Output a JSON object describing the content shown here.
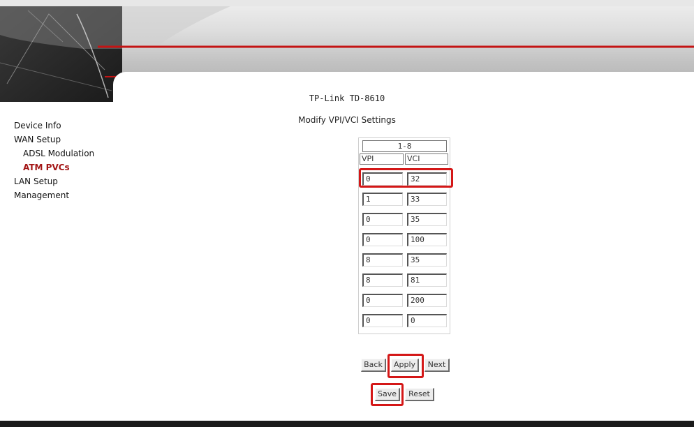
{
  "sidebar": {
    "items": [
      {
        "label": "Device Info"
      },
      {
        "label": "WAN Setup"
      },
      {
        "label": "ADSL Modulation"
      },
      {
        "label": "ATM PVCs"
      },
      {
        "label": "LAN Setup"
      },
      {
        "label": "Management"
      }
    ]
  },
  "main": {
    "device_title": "TP-Link TD-8610",
    "page_title": "Modify VPI/VCI Settings",
    "range_label": "1-8",
    "columns": {
      "vpi": "VPI",
      "vci": "VCI"
    },
    "rows": [
      {
        "vpi": "0",
        "vci": "32"
      },
      {
        "vpi": "1",
        "vci": "33"
      },
      {
        "vpi": "0",
        "vci": "35"
      },
      {
        "vpi": "0",
        "vci": "100"
      },
      {
        "vpi": "8",
        "vci": "35"
      },
      {
        "vpi": "8",
        "vci": "81"
      },
      {
        "vpi": "0",
        "vci": "200"
      },
      {
        "vpi": "0",
        "vci": "0"
      }
    ],
    "buttons": {
      "back": "Back",
      "apply": "Apply",
      "next": "Next",
      "save": "Save",
      "reset": "Reset"
    }
  },
  "colors": {
    "accent": "#d41717",
    "active_menu": "#a31515"
  }
}
